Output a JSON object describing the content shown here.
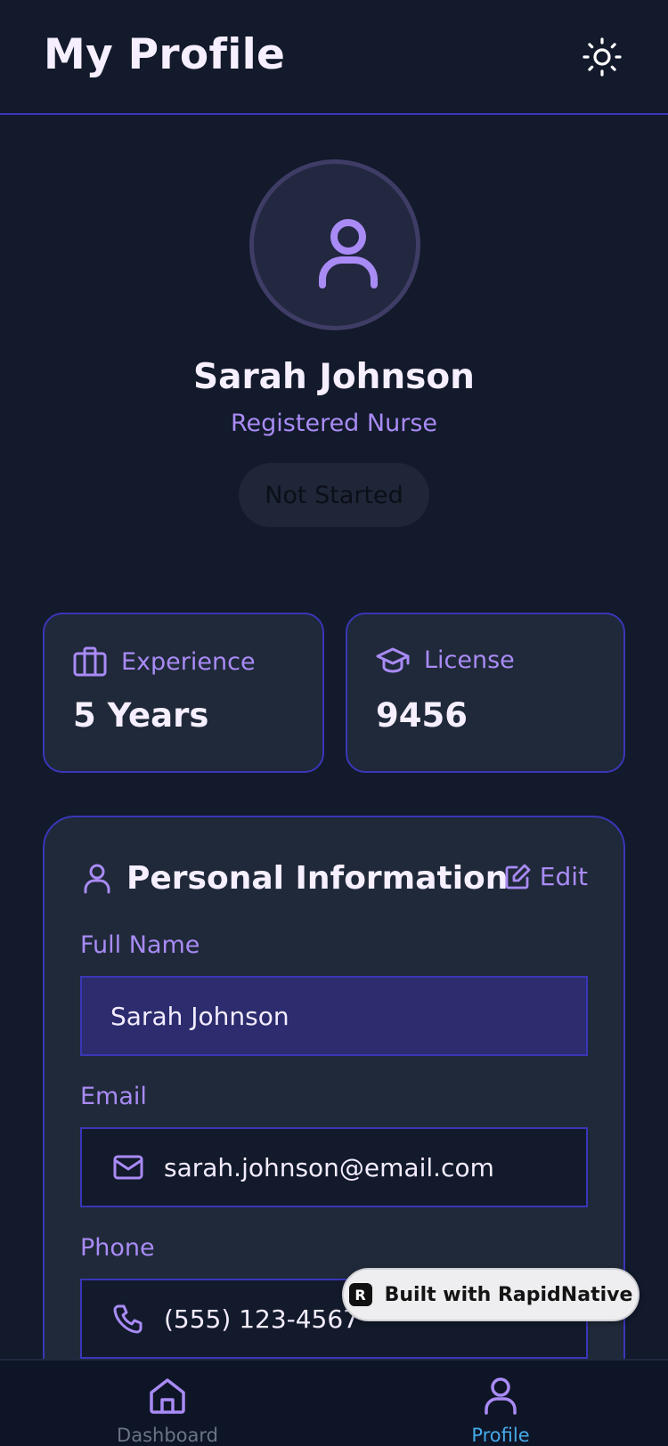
{
  "header": {
    "title": "My Profile",
    "theme_icon": "sun-icon"
  },
  "profile": {
    "name": "Sarah Johnson",
    "role": "Registered Nurse",
    "status": "Not Started"
  },
  "stats": {
    "experience": {
      "label": "Experience",
      "value": "5 Years",
      "icon": "briefcase-icon"
    },
    "license": {
      "label": "License",
      "value": "9456",
      "icon": "graduation-cap-icon"
    }
  },
  "personal_info": {
    "title": "Personal Information",
    "edit_label": "Edit",
    "fields": {
      "full_name": {
        "label": "Full Name",
        "value": "Sarah Johnson"
      },
      "email": {
        "label": "Email",
        "value": "sarah.johnson@email.com"
      },
      "phone": {
        "label": "Phone",
        "value": "(555) 123-4567"
      }
    }
  },
  "badge": {
    "logo": "R",
    "text": "Built with RapidNative"
  },
  "tabs": [
    {
      "label": "Dashboard",
      "icon": "home-icon",
      "active": false
    },
    {
      "label": "Profile",
      "icon": "user-icon",
      "active": true
    }
  ],
  "colors": {
    "background": "#121a2b",
    "card": "#1f2939",
    "accent": "#a98bf5",
    "border": "#3b36b8",
    "active_tab": "#46a9e8"
  }
}
